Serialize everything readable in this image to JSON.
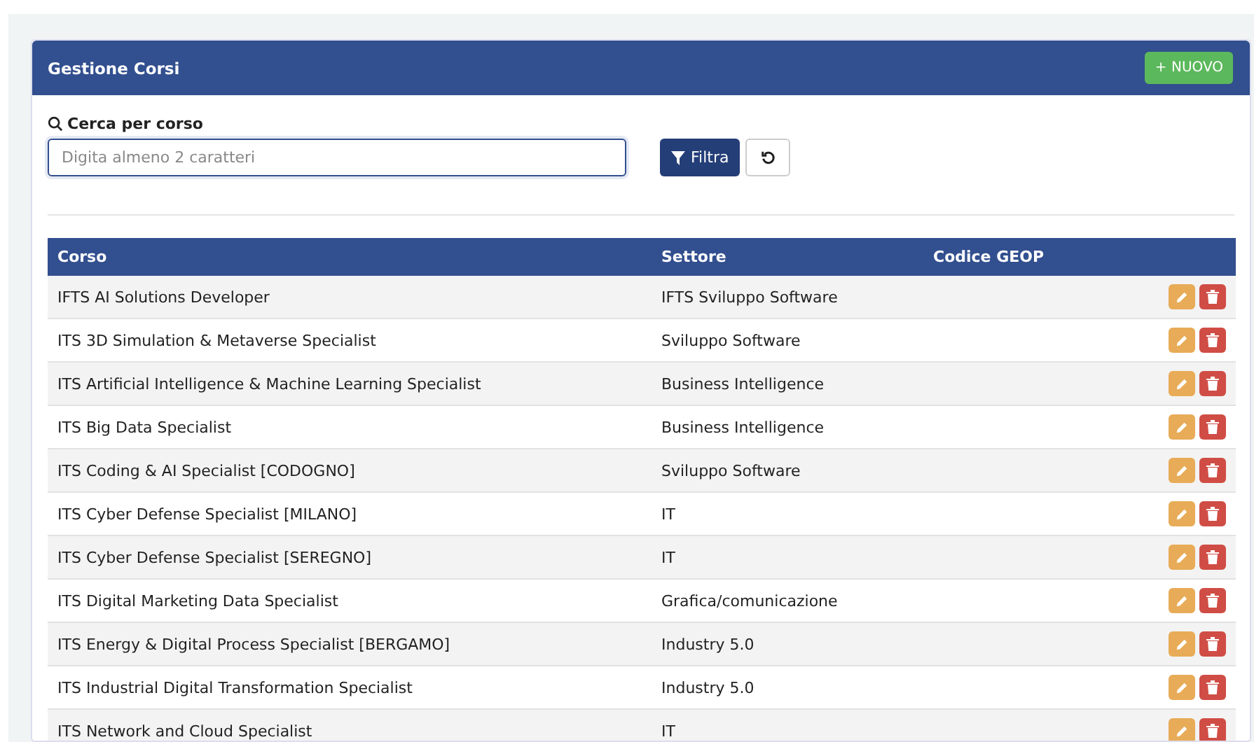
{
  "panel": {
    "title": "Gestione Corsi",
    "new_button": "+ NUOVO"
  },
  "search": {
    "label": "Cerca per corso",
    "placeholder": "Digita almeno 2 caratteri",
    "filter_button": "Filtra"
  },
  "table": {
    "columns": [
      "Corso",
      "Settore",
      "Codice GEOP"
    ],
    "rows": [
      {
        "corso": "IFTS AI Solutions Developer",
        "settore": "IFTS Sviluppo Software"
      },
      {
        "corso": "ITS 3D Simulation & Metaverse Specialist",
        "settore": "Sviluppo Software"
      },
      {
        "corso": "ITS Artificial Intelligence & Machine Learning Specialist",
        "settore": "Business Intelligence"
      },
      {
        "corso": "ITS Big Data Specialist",
        "settore": "Business Intelligence"
      },
      {
        "corso": "ITS Coding & AI Specialist [CODOGNO]",
        "settore": "Sviluppo Software"
      },
      {
        "corso": "ITS Cyber Defense Specialist [MILANO]",
        "settore": "IT"
      },
      {
        "corso": "ITS Cyber Defense Specialist [SEREGNO]",
        "settore": "IT"
      },
      {
        "corso": "ITS Digital Marketing Data Specialist",
        "settore": "Grafica/comunicazione"
      },
      {
        "corso": "ITS Energy & Digital Process Specialist [BERGAMO]",
        "settore": "Industry 5.0"
      },
      {
        "corso": "ITS Industrial Digital Transformation Specialist",
        "settore": "Industry 5.0"
      },
      {
        "corso": "ITS Network and Cloud Specialist",
        "settore": "IT"
      }
    ]
  }
}
